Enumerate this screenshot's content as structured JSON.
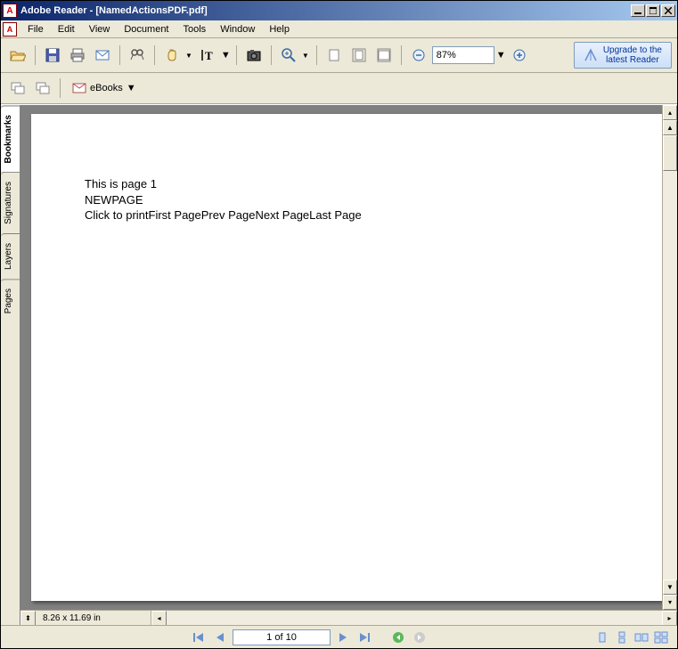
{
  "title": "Adobe Reader - [NamedActionsPDF.pdf]",
  "menus": [
    "File",
    "Edit",
    "View",
    "Document",
    "Tools",
    "Window",
    "Help"
  ],
  "toolbar": {
    "zoom_value": "87%",
    "ebooks_label": "eBooks"
  },
  "upgrade": {
    "line1": "Upgrade to the",
    "line2": "latest Reader"
  },
  "side_tabs": [
    {
      "label": "Bookmarks",
      "active": true
    },
    {
      "label": "Signatures",
      "active": false
    },
    {
      "label": "Layers",
      "active": false
    },
    {
      "label": "Pages",
      "active": false
    }
  ],
  "document": {
    "line1": "This is page 1",
    "line2": "NEWPAGE",
    "line3": "Click to printFirst PagePrev PageNext PageLast Page"
  },
  "page_dims": "8.26 x 11.69 in",
  "status": {
    "page_field": "1 of 10"
  }
}
